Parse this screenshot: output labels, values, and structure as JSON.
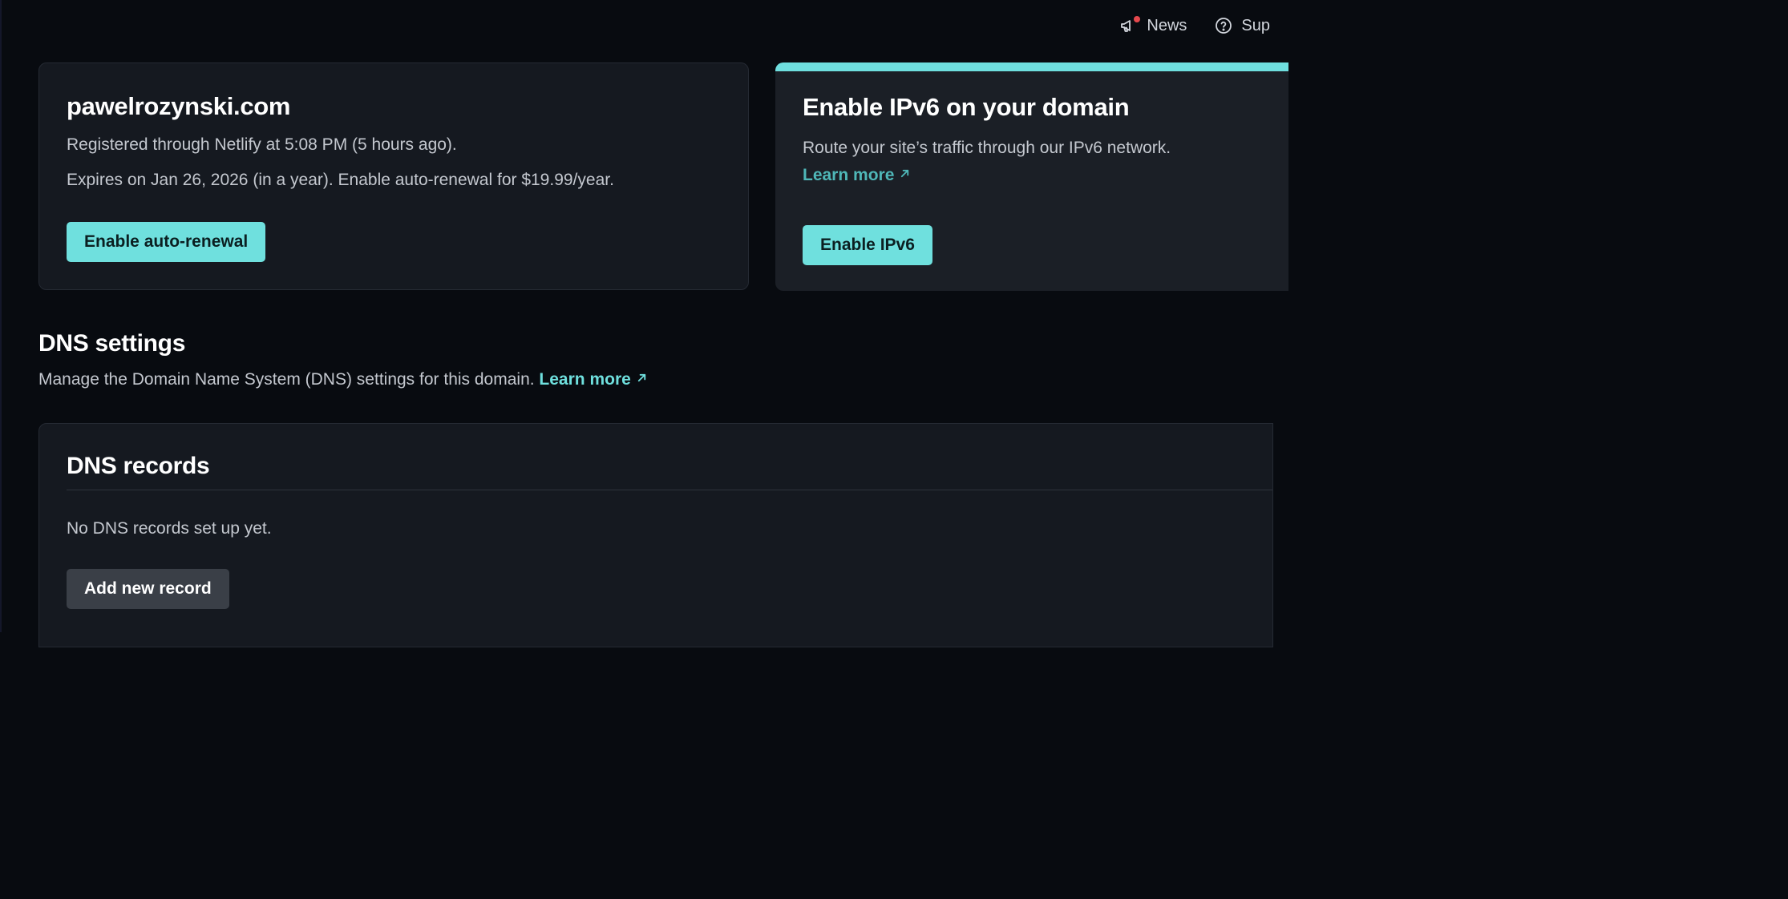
{
  "topbar": {
    "news_label": "News",
    "support_label": "Sup"
  },
  "domain_card": {
    "title": "pawelrozynski.com",
    "registered_text": "Registered through Netlify at 5:08 PM (5 hours ago).",
    "expires_text": "Expires on Jan 26, 2026 (in a year). Enable auto-renewal for $19.99/year.",
    "button_label": "Enable auto-renewal"
  },
  "ipv6_card": {
    "title": "Enable IPv6 on your domain",
    "description": "Route your site’s traffic through our IPv6 network.",
    "learn_more_label": "Learn more",
    "button_label": "Enable IPv6",
    "accent_color": "#6fdfdf"
  },
  "dns_settings": {
    "title": "DNS settings",
    "description": "Manage the Domain Name System (DNS) settings for this domain.",
    "learn_more_label": "Learn more"
  },
  "dns_records": {
    "title": "DNS records",
    "empty_text": "No DNS records set up yet.",
    "button_label": "Add new record"
  },
  "icons": {
    "news": "megaphone-icon",
    "support": "question-circle-icon",
    "external_link": "arrow-up-right-icon"
  },
  "colors": {
    "background": "#080b10",
    "card": "#151920",
    "primary_button": "#6fe0de",
    "secondary_button": "#3a3f47",
    "link": "#4fb7b8",
    "notification_dot": "#e5484d"
  }
}
